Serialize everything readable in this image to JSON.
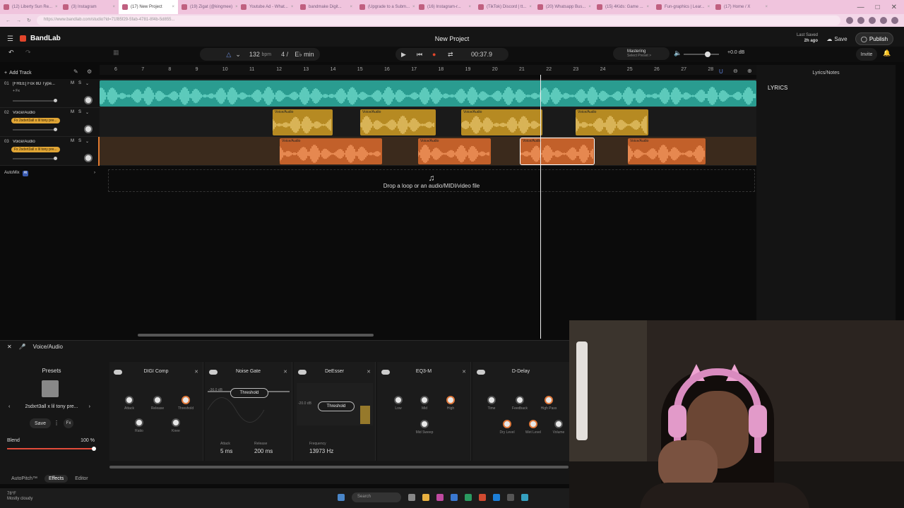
{
  "browser": {
    "tabs": [
      {
        "label": "(12) Liberty Sun Re...",
        "active": false
      },
      {
        "label": "(3) Instagram",
        "active": false
      },
      {
        "label": "(17) New Project",
        "active": true
      },
      {
        "label": "(19) Zigat (@kingmee)",
        "active": false
      },
      {
        "label": "Youtube Ad - What...",
        "active": false
      },
      {
        "label": "bandmake Digit...",
        "active": false
      },
      {
        "label": "(Upgrade to a Subm...",
        "active": false
      },
      {
        "label": "(16) Instagram-r...",
        "active": false
      },
      {
        "label": "(TikTok) Discord | tt...",
        "active": false
      },
      {
        "label": "(20) Whatsapp Bus...",
        "active": false
      },
      {
        "label": "(15) 4Kids: Game ...",
        "active": false
      },
      {
        "label": "Fun-graphics | Lear...",
        "active": false
      },
      {
        "label": "(17) Home / X",
        "active": false
      }
    ],
    "url": "https://www.bandlab.com/studio?id=71f85f29-5fab-4781-8f4b-5d855..."
  },
  "header": {
    "logo": "BandLab",
    "project_title": "New Project",
    "last_saved_label": "Last Saved",
    "last_saved_value": "2h ago",
    "save_label": "Save",
    "publish_label": "Publish",
    "invite_label": "Invite",
    "notif_count": "2"
  },
  "transport": {
    "tempo": "132",
    "tempo_unit": "bpm",
    "time_sig": "4 / 4",
    "key": "E♭ min",
    "time": "00:37.9",
    "mastering_label": "Mastering",
    "mastering_preset": "Select Preset >",
    "volume": "+0.0 dB"
  },
  "ruler": {
    "bars": [
      "6",
      "7",
      "8",
      "9",
      "10",
      "11",
      "12",
      "13",
      "14",
      "15",
      "16",
      "17",
      "18",
      "19",
      "20",
      "21",
      "22",
      "23",
      "24",
      "25",
      "26",
      "27",
      "28"
    ]
  },
  "tracks": [
    {
      "num": "01",
      "name": "[FREE] Fox 8D Type...",
      "fx": "+ Fx",
      "fx_active": false,
      "color": "#3dbfb0"
    },
    {
      "num": "02",
      "name": "Voice/Audio",
      "fx": "Fx 2sdxrt3all x lil tony pre...",
      "fx_active": true,
      "color": "#d8a82e"
    },
    {
      "num": "03",
      "name": "Voice/Audio",
      "fx": "Fx 2sdxrt3all x lil tony pre...",
      "fx_active": true,
      "color": "#e07a30"
    }
  ],
  "clips": {
    "track2": [
      {
        "label": "Voice/Audio"
      },
      {
        "label": "Voice/Audio"
      },
      {
        "label": "Voice/Audio"
      },
      {
        "label": "Voice/Audio"
      }
    ],
    "track3": [
      {
        "label": "Voice/Audio"
      },
      {
        "label": "Voice/Audio"
      },
      {
        "label": "Voice/Audio"
      },
      {
        "label": "Voice/Audio"
      }
    ]
  },
  "add_track_label": "Add Track",
  "automix_label": "AutoMix",
  "automix_badge": "AI",
  "drop_text": "Drop a loop or an audio/MIDI/video file",
  "lyrics_panel": {
    "header": "Lyrics/Notes",
    "title": "LYRICS"
  },
  "fx_panel": {
    "title": "Voice/Audio",
    "presets_header": "Presets",
    "preset_name": "2sdxrt3all x lil tony pre...",
    "save_label": "Save",
    "fx_btn": "Fx",
    "blend_label": "Blend",
    "blend_value": "100 %",
    "plugins": [
      {
        "name": "DIGI Comp",
        "knobs": [
          "Attack",
          "Release",
          "Threshold",
          "Ratio",
          "Knee"
        ]
      },
      {
        "name": "Noise Gate",
        "threshold": "Threshold",
        "db": "-36.0 dB",
        "attack_label": "Attack",
        "attack_value": "5 ms",
        "release_label": "Release",
        "release_value": "200 ms"
      },
      {
        "name": "DeEsser",
        "threshold": "Threshold",
        "db": "-20.0 dB",
        "freq_label": "Frequency",
        "freq_value": "13973 Hz"
      },
      {
        "name": "EQ3-M",
        "knobs": [
          "Low",
          "Mid",
          "High",
          "Mid Sweep"
        ]
      },
      {
        "name": "D-Delay",
        "knobs": [
          "Time",
          "Feedback",
          "High Pass",
          "Dry Level",
          "Wet Level",
          "Volume"
        ]
      }
    ],
    "tabs": [
      "AutoPitch™",
      "Effects",
      "Editor"
    ],
    "active_tab": "Effects"
  },
  "taskbar": {
    "weather_temp": "78°F",
    "weather_desc": "Mostly cloudy",
    "search_placeholder": "Search"
  }
}
